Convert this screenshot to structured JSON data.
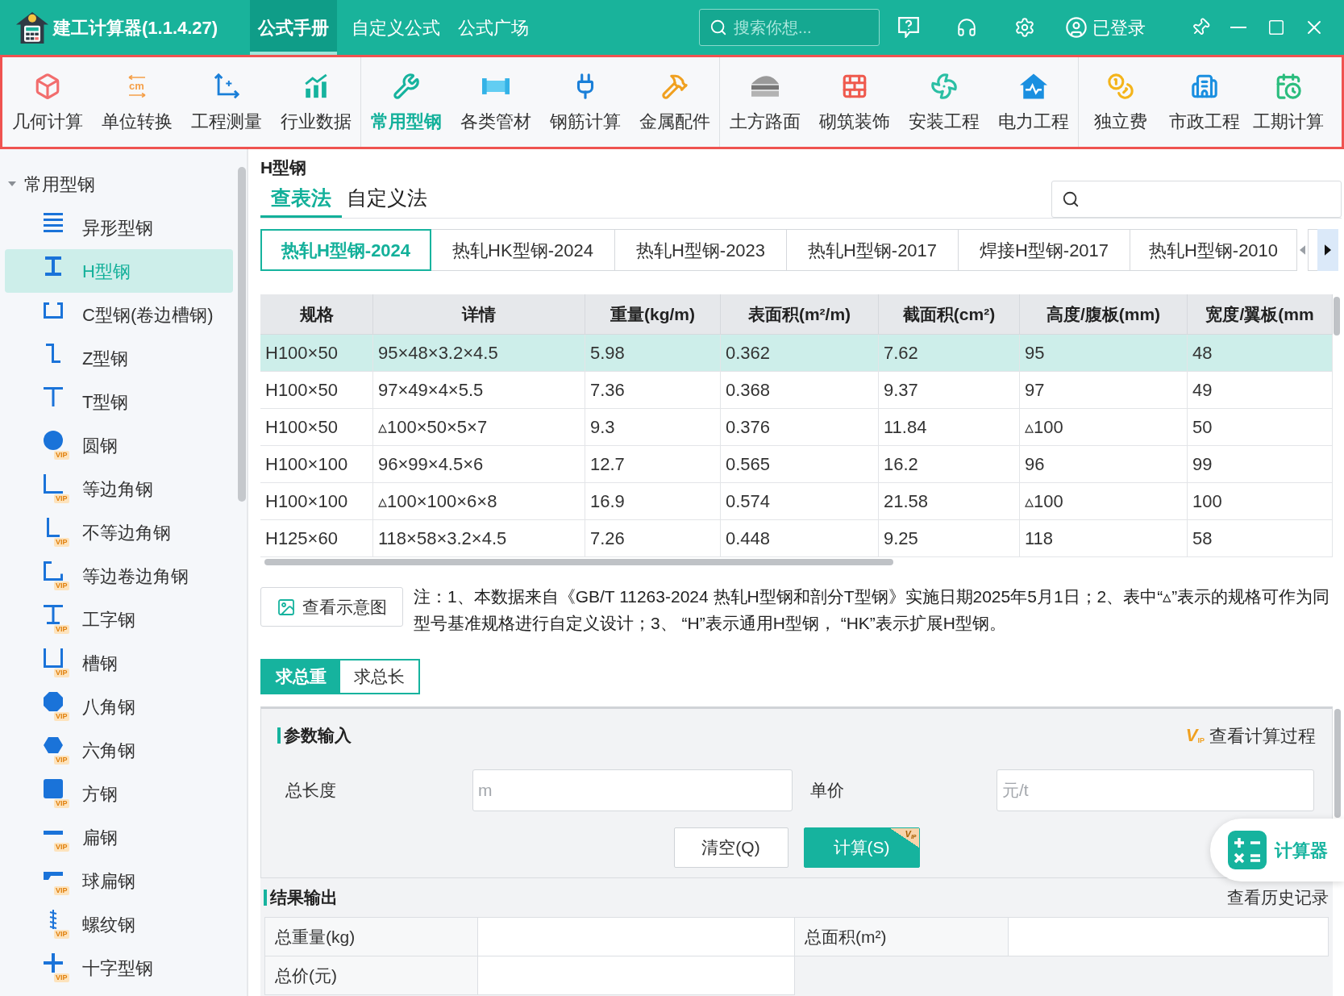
{
  "window": {
    "title": "建工计算器(1.1.4.27)"
  },
  "nav_tabs": [
    {
      "label": "公式手册",
      "selected": true
    },
    {
      "label": "自定义公式",
      "selected": false
    },
    {
      "label": "公式广场",
      "selected": false
    }
  ],
  "search": {
    "placeholder": "搜索你想..."
  },
  "account": {
    "label": "已登录"
  },
  "toolbar": {
    "groups": [
      {
        "items": [
          {
            "label": "几何计算",
            "selected": false
          },
          {
            "label": "单位转换",
            "selected": false,
            "icon_text": "cm"
          },
          {
            "label": "工程测量",
            "selected": false
          },
          {
            "label": "行业数据",
            "selected": false
          }
        ]
      },
      {
        "items": [
          {
            "label": "常用型钢",
            "selected": true
          },
          {
            "label": "各类管材",
            "selected": false
          },
          {
            "label": "钢筋计算",
            "selected": false
          },
          {
            "label": "金属配件",
            "selected": false
          }
        ]
      },
      {
        "items": [
          {
            "label": "土方路面",
            "selected": false
          },
          {
            "label": "砌筑装饰",
            "selected": false
          },
          {
            "label": "安装工程",
            "selected": false
          },
          {
            "label": "电力工程",
            "selected": false
          }
        ]
      },
      {
        "items": [
          {
            "label": "独立费",
            "selected": false
          },
          {
            "label": "市政工程",
            "selected": false
          },
          {
            "label": "工期计算",
            "selected": false
          }
        ]
      }
    ]
  },
  "sidebar": {
    "tree": [
      {
        "label": "常用型钢",
        "expanded": true,
        "children": [
          {
            "label": "异形型钢",
            "selected": false
          },
          {
            "label": "H型钢",
            "selected": true
          },
          {
            "label": "C型钢(卷边槽钢)",
            "selected": false
          },
          {
            "label": "Z型钢",
            "selected": false
          },
          {
            "label": "T型钢",
            "selected": false
          },
          {
            "label": "圆钢",
            "selected": false,
            "badge": "VIP"
          },
          {
            "label": "等边角钢",
            "selected": false,
            "badge": "VIP"
          },
          {
            "label": "不等边角钢",
            "selected": false,
            "badge": "VIP"
          },
          {
            "label": "等边卷边角钢",
            "selected": false,
            "badge": "VIP"
          },
          {
            "label": "工字钢",
            "selected": false,
            "badge": "VIP"
          },
          {
            "label": "槽钢",
            "selected": false,
            "badge": "VIP"
          },
          {
            "label": "八角钢",
            "selected": false,
            "badge": "VIP"
          },
          {
            "label": "六角钢",
            "selected": false,
            "badge": "VIP"
          },
          {
            "label": "方钢",
            "selected": false,
            "badge": "VIP"
          },
          {
            "label": "扁钢",
            "selected": false,
            "badge": "VIP"
          },
          {
            "label": "球扁钢",
            "selected": false,
            "badge": "VIP"
          },
          {
            "label": "螺纹钢",
            "selected": false,
            "badge": "VIP"
          },
          {
            "label": "十字型钢",
            "selected": false,
            "badge": "VIP"
          }
        ]
      }
    ]
  },
  "page_title": "H型钢",
  "method_tabs": [
    {
      "label": "查表法",
      "selected": true
    },
    {
      "label": "自定义法",
      "selected": false
    }
  ],
  "standard_tabs": [
    {
      "label": "热轧H型钢-2024",
      "selected": true
    },
    {
      "label": "热轧HK型钢-2024",
      "selected": false
    },
    {
      "label": "热轧H型钢-2023",
      "selected": false
    },
    {
      "label": "热轧H型钢-2017",
      "selected": false
    },
    {
      "label": "焊接H型钢-2017",
      "selected": false
    },
    {
      "label": "热轧H型钢-2010",
      "selected": false
    }
  ],
  "table": {
    "columns": [
      "规格",
      "详情",
      "重量(kg/m)",
      "表面积(m²/m)",
      "截面积(cm²)",
      "高度/腹板(mm)",
      "宽度/翼板(mm"
    ],
    "rows": [
      {
        "selected": true,
        "cells": [
          "H100×50",
          "95×48×3.2×4.5",
          "5.98",
          "0.362",
          "7.62",
          "95",
          "48"
        ]
      },
      {
        "selected": false,
        "cells": [
          "H100×50",
          "97×49×4×5.5",
          "7.36",
          "0.368",
          "9.37",
          "97",
          "49"
        ]
      },
      {
        "selected": false,
        "cells": [
          "H100×50",
          "▵100×50×5×7",
          "9.3",
          "0.376",
          "11.84",
          "▵100",
          "50"
        ]
      },
      {
        "selected": false,
        "cells": [
          "H100×100",
          "96×99×4.5×6",
          "12.7",
          "0.565",
          "16.2",
          "96",
          "99"
        ]
      },
      {
        "selected": false,
        "cells": [
          "H100×100",
          "▵100×100×6×8",
          "16.9",
          "0.574",
          "21.58",
          "▵100",
          "100"
        ]
      },
      {
        "selected": false,
        "cells": [
          "H125×60",
          "118×58×3.2×4.5",
          "7.26",
          "0.448",
          "9.25",
          "118",
          "58"
        ]
      }
    ]
  },
  "diagram_button": {
    "label": "查看示意图"
  },
  "note": "注：1、本数据来自《GB/T 11263-2024 热轧H型钢和剖分T型钢》实施日期2025年5月1日；2、表中“▵”表示的规格可作为同型号基准规格进行自定义设计；3、 “H”表示通用H型钢， “HK”表示扩展H型钢。",
  "mode_tabs": [
    {
      "label": "求总重",
      "selected": true
    },
    {
      "label": "求总长",
      "selected": false
    }
  ],
  "input_panel": {
    "title": "参数输入",
    "process_link": {
      "badge": "V$_{IP}$",
      "label": "查看计算过程"
    },
    "fields": [
      {
        "label": "总长度",
        "placeholder": "m"
      },
      {
        "label": "单价",
        "placeholder": "元/t"
      }
    ],
    "buttons": [
      {
        "label": "清空(Q)",
        "kind": "secondary"
      },
      {
        "label": "计算(S)",
        "kind": "primary",
        "badge": "V$_{IP}$"
      }
    ]
  },
  "result_panel": {
    "title": "结果输出",
    "history_link": "查看历史记录",
    "fields": [
      {
        "label": "总重量(kg)"
      },
      {
        "label": "总面积(m²)"
      },
      {
        "label": "总价(元)"
      }
    ]
  },
  "calculator_button": {
    "label": "计算器"
  }
}
